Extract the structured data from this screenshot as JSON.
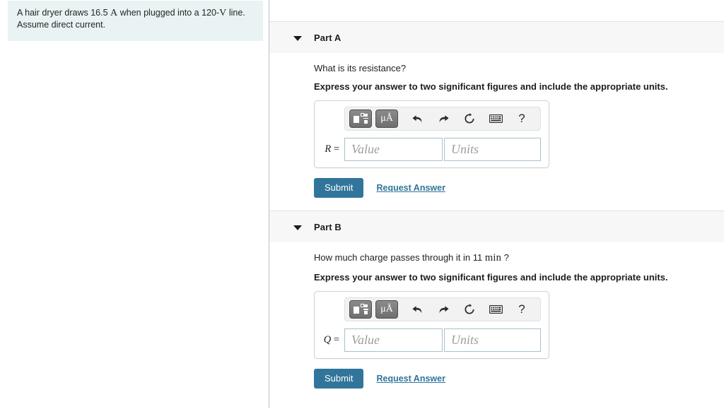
{
  "problem": {
    "text_before_current": "A hair dryer draws 16.5",
    "current_unit": "A",
    "text_middle": "when plugged into a 120-",
    "voltage_unit": "V",
    "text_after": "line.",
    "second_line": "Assume direct current."
  },
  "toolbar": {
    "template_button_label": "template-picker",
    "units_button_label": "μÅ",
    "undo_label": "undo",
    "redo_label": "redo",
    "reset_label": "reset",
    "keyboard_label": "keyboard",
    "help_label": "?"
  },
  "input_defaults": {
    "value_placeholder": "Value",
    "units_placeholder": "Units",
    "value_current": "",
    "units_current": ""
  },
  "actions": {
    "submit_label": "Submit",
    "request_answer_label": "Request Answer"
  },
  "colors": {
    "accent_blue": "#31759b",
    "problem_panel_bg": "#e9f3f3",
    "part_header_bg": "#f7f7f7",
    "input_border": "#a9c0cd"
  },
  "parts": [
    {
      "id": "part-a",
      "title": "Part A",
      "question_prefix": "What is its resistance?",
      "question_math": "",
      "question_suffix": "",
      "instruction": "Express your answer to two significant figures and include the appropriate units.",
      "variable": "R",
      "variable_equals": "R ="
    },
    {
      "id": "part-b",
      "title": "Part B",
      "question_prefix": "How much charge passes through it in 11",
      "question_math": "min",
      "question_suffix": "?",
      "instruction": "Express your answer to two significant figures and include the appropriate units.",
      "variable": "Q",
      "variable_equals": "Q ="
    }
  ]
}
